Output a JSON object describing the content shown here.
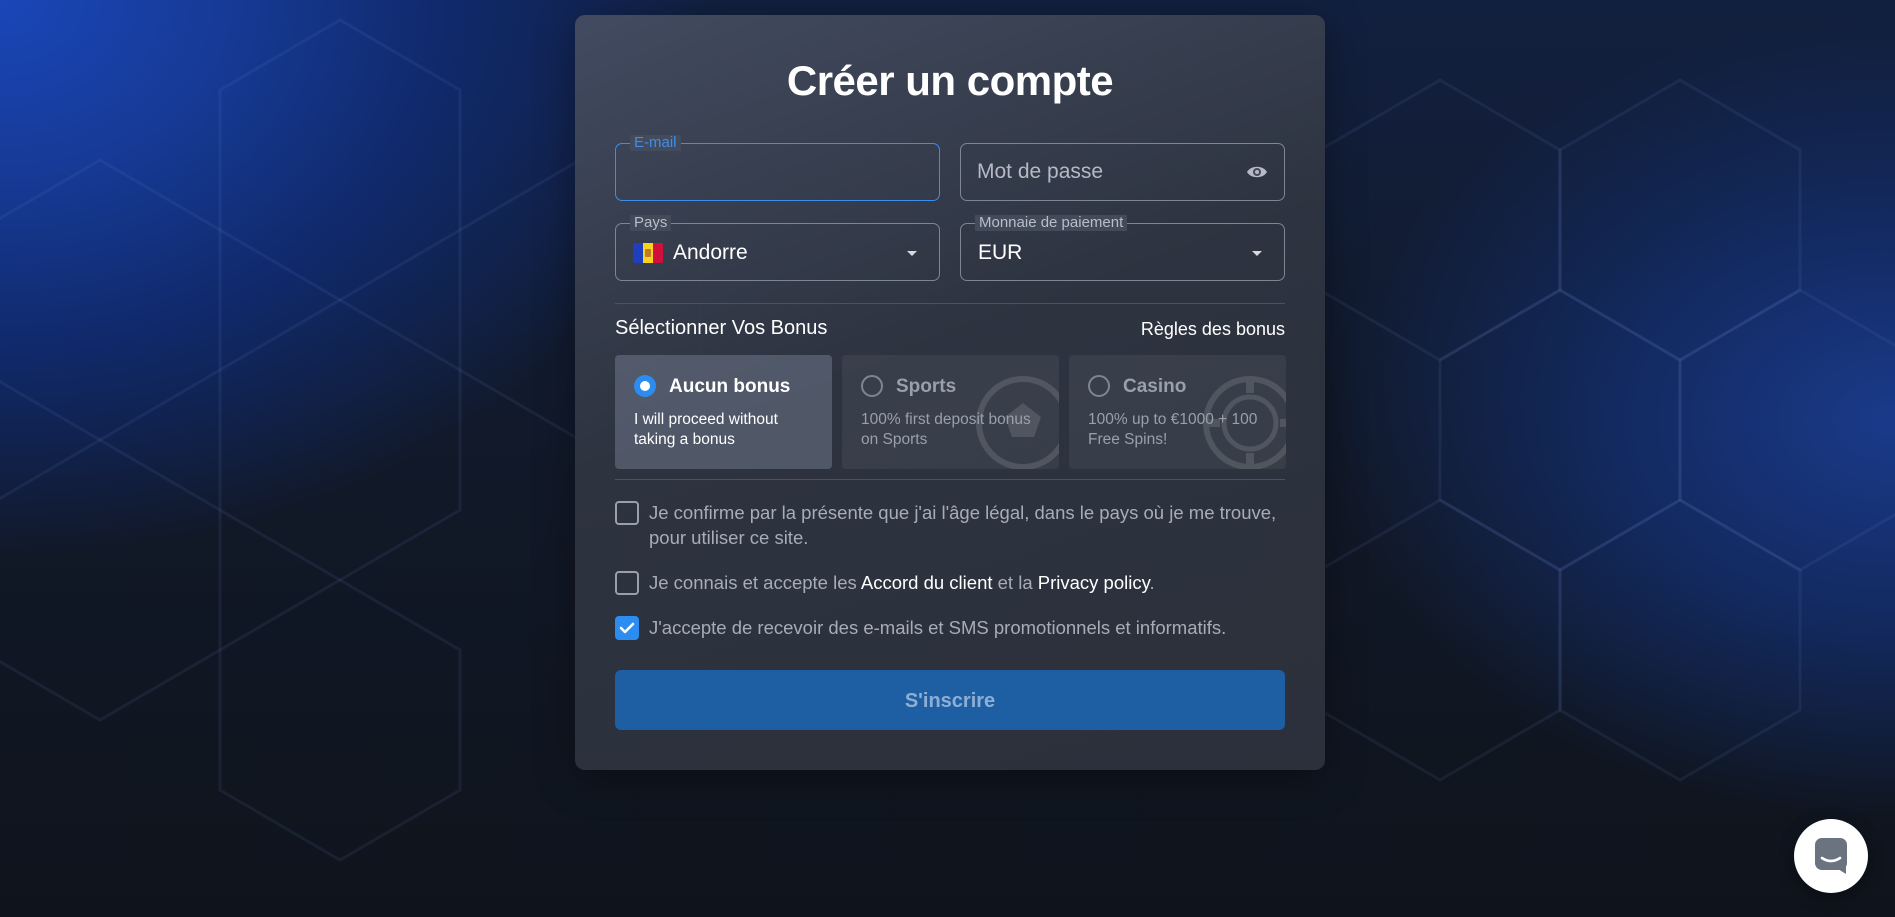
{
  "title": "Créer un compte",
  "email": {
    "label": "E-mail",
    "value": ""
  },
  "password": {
    "placeholder": "Mot de passe",
    "toggle_icon": "eye-icon"
  },
  "country": {
    "label": "Pays",
    "value": "Andorre",
    "flag": "andorra-flag-icon"
  },
  "currency": {
    "label": "Monnaie de paiement",
    "value": "EUR"
  },
  "bonus": {
    "section_title": "Sélectionner Vos Bonus",
    "rules_link": "Règles des bonus",
    "options": [
      {
        "name": "Aucun bonus",
        "description": "I will proceed without taking a bonus",
        "selected": true
      },
      {
        "name": "Sports",
        "description": "100% first deposit bonus on Sports",
        "selected": false
      },
      {
        "name": "Casino",
        "description": "100% up to €1000 + 100 Free Spins!",
        "selected": false
      }
    ]
  },
  "consents": {
    "age": {
      "text": "Je confirme par la présente que j'ai l'âge légal, dans le pays où je me trouve, pour utiliser ce site.",
      "checked": false
    },
    "terms": {
      "prefix": "Je connais et accepte les",
      "link1": "Accord du client",
      "middle": "et la",
      "link2": "Privacy policy",
      "suffix": ".",
      "checked": false
    },
    "marketing": {
      "text": "J'accepte de recevoir des e-mails et SMS promotionnels et informatifs.",
      "checked": true
    }
  },
  "submit_label": "S'inscrire",
  "colors": {
    "accent": "#2c8cf0",
    "button": "#1e5fa3",
    "card": "#3a404d"
  },
  "chat": {
    "icon": "chat-icon"
  }
}
